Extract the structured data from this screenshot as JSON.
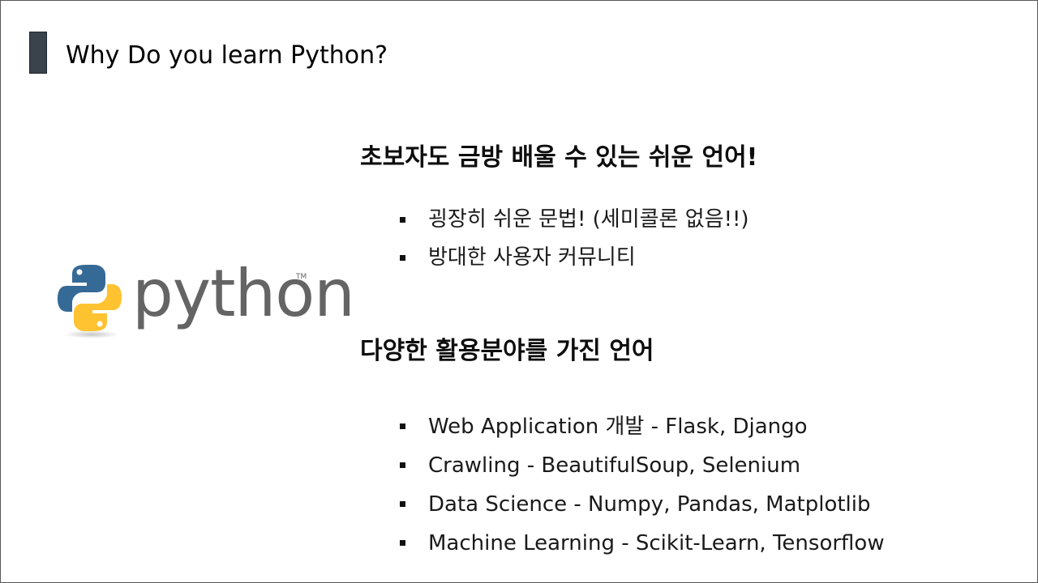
{
  "slide": {
    "title": "Why Do you learn Python?"
  },
  "logo": {
    "wordmark": "python",
    "trademark": "TM",
    "colors": {
      "blue": "#366a96",
      "yellow": "#ffc331",
      "text": "#646464"
    }
  },
  "sections": [
    {
      "heading": "초보자도 금방 배울 수 있는 쉬운 언어!",
      "bullets": [
        "굉장히 쉬운 문법! (세미콜론 없음!!)",
        "방대한 사용자 커뮤니티"
      ]
    },
    {
      "heading": "다양한 활용분야를 가진 언어",
      "bullets": [
        "Web Application 개발 - Flask, Django",
        "Crawling - BeautifulSoup, Selenium",
        "Data Science - Numpy, Pandas, Matplotlib",
        "Machine Learning - Scikit-Learn, Tensorflow"
      ]
    }
  ],
  "colors": {
    "accent_bar": "#3a424b",
    "border": "#595959"
  }
}
